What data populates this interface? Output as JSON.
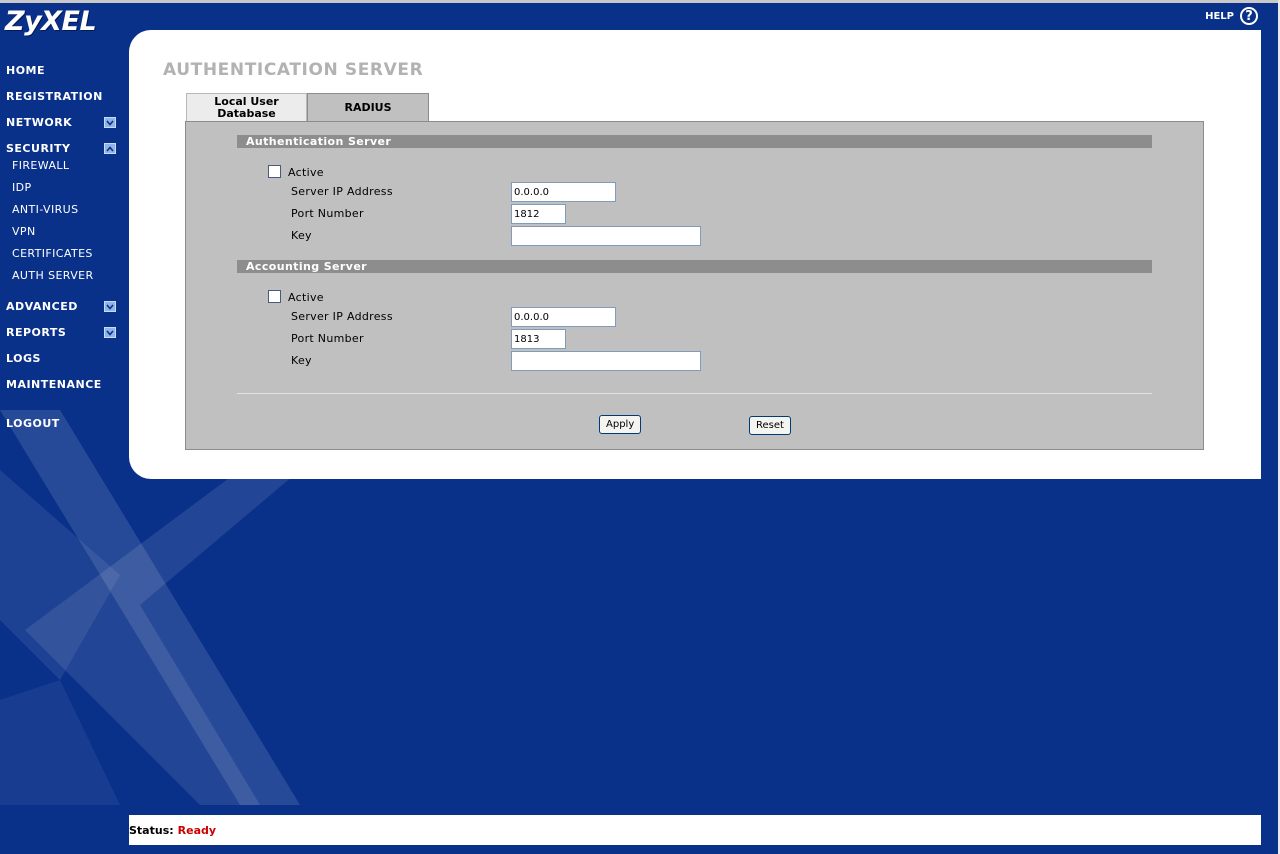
{
  "brand": {
    "logo": "ZyXEL"
  },
  "help": {
    "label": "HELP",
    "icon": "question-circle-icon"
  },
  "sidebar": {
    "items": [
      {
        "label": "HOME"
      },
      {
        "label": "REGISTRATION"
      },
      {
        "label": "NETWORK",
        "toggle": "expand"
      },
      {
        "label": "SECURITY",
        "toggle": "collapse"
      },
      {
        "label": "ADVANCED",
        "toggle": "expand"
      },
      {
        "label": "REPORTS",
        "toggle": "expand"
      },
      {
        "label": "LOGS"
      },
      {
        "label": "MAINTENANCE"
      },
      {
        "label": "LOGOUT"
      }
    ],
    "security_sub": [
      "FIREWALL",
      "IDP",
      "ANTI-VIRUS",
      "VPN",
      "CERTIFICATES",
      "AUTH SERVER"
    ]
  },
  "main": {
    "title": "AUTHENTICATION SERVER",
    "tabs": [
      {
        "label": "Local User Database",
        "active": false
      },
      {
        "label": "RADIUS",
        "active": true
      }
    ],
    "auth_server": {
      "heading": "Authentication Server",
      "active_label": "Active",
      "active": false,
      "ip_label": "Server IP Address",
      "ip_value": "0.0.0.0",
      "port_label": "Port Number",
      "port_value": "1812",
      "key_label": "Key",
      "key_value": ""
    },
    "accounting_server": {
      "heading": "Accounting Server",
      "active_label": "Active",
      "active": false,
      "ip_label": "Server IP Address",
      "ip_value": "0.0.0.0",
      "port_label": "Port Number",
      "port_value": "1813",
      "key_label": "Key",
      "key_value": ""
    },
    "buttons": {
      "apply": "Apply",
      "reset": "Reset"
    }
  },
  "status": {
    "label": "Status:",
    "value": "Ready"
  },
  "colors": {
    "background": "#0a318a",
    "panel": "#ffffff",
    "content": "#c0c0c0",
    "section_bar": "#8d8d8d",
    "status_ready": "#cc0000"
  }
}
